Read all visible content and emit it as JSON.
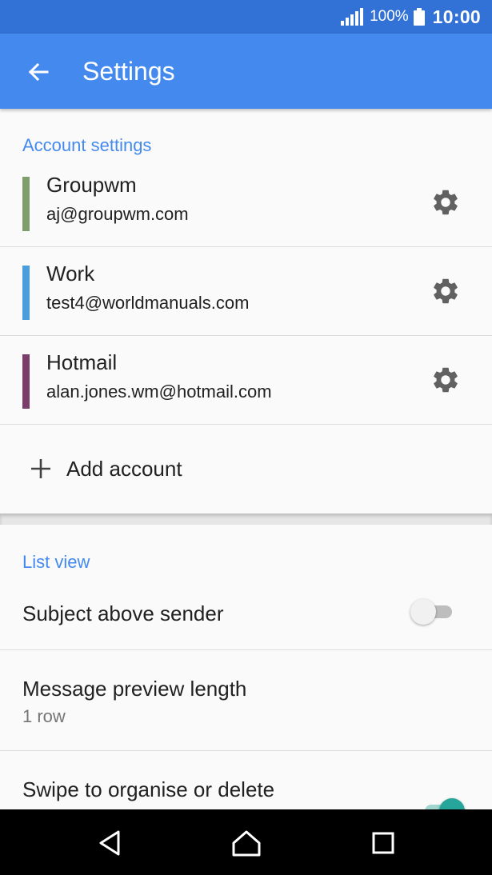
{
  "status_bar": {
    "battery_percent": "100%",
    "time": "10:00"
  },
  "app_bar": {
    "title": "Settings",
    "back_icon": "arrow-left-icon"
  },
  "account_settings": {
    "header": "Account settings",
    "accounts": [
      {
        "name": "Groupwm",
        "email": "aj@groupwm.com",
        "color": "#7f9e6c"
      },
      {
        "name": "Work",
        "email": "test4@worldmanuals.com",
        "color": "#4b9ede"
      },
      {
        "name": "Hotmail",
        "email": "alan.jones.wm@hotmail.com",
        "color": "#7b3e6a"
      }
    ],
    "add_account_label": "Add account"
  },
  "list_view": {
    "header": "List view",
    "subject_above_sender": {
      "label": "Subject above sender",
      "enabled": false
    },
    "message_preview": {
      "label": "Message preview length",
      "value": "1 row"
    },
    "swipe": {
      "label": "Swipe to organise or delete",
      "enabled": true
    }
  },
  "colors": {
    "status_bar": "#3271d6",
    "app_bar": "#448aee",
    "accent": "#448aee",
    "toggle_on": "#26a69a"
  },
  "nav_bar": {
    "back_icon": "triangle-back-icon",
    "home_icon": "home-icon",
    "recents_icon": "square-recents-icon"
  }
}
